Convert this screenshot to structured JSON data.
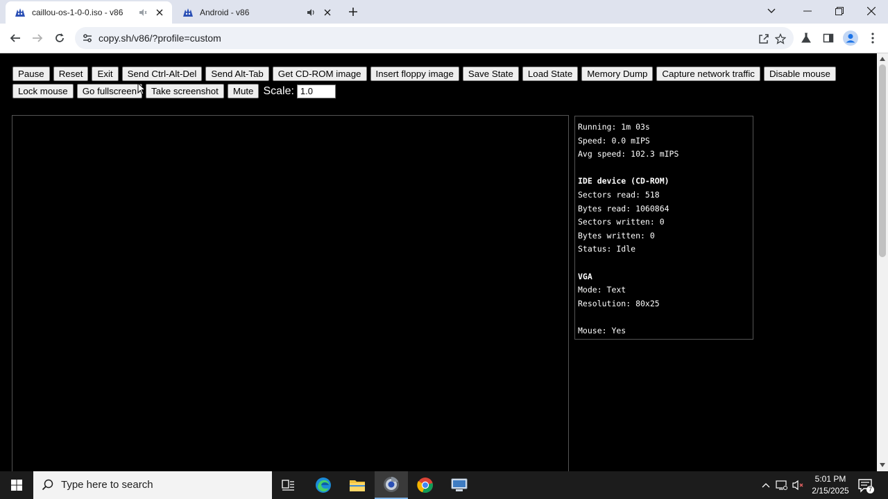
{
  "browser": {
    "tabs": [
      {
        "title": "caillou-os-1-0-0.iso - v86",
        "active": true
      },
      {
        "title": "Android - v86",
        "active": false
      }
    ],
    "url": "copy.sh/v86/?profile=custom"
  },
  "controls": {
    "row1": [
      "Pause",
      "Reset",
      "Exit",
      "Send Ctrl-Alt-Del",
      "Send Alt-Tab",
      "Get CD-ROM image",
      "Insert floppy image",
      "Save State",
      "Load State",
      "Memory Dump",
      "Capture network traffic",
      "Disable mouse"
    ],
    "row2": [
      "Lock mouse",
      "Go fullscreen",
      "Take screenshot",
      "Mute"
    ],
    "scale_label": "Scale:",
    "scale_value": "1.0"
  },
  "stats": {
    "running": "Running: 1m 03s",
    "speed": "Speed: 0.0 mIPS",
    "avg_speed": "Avg speed: 102.3 mIPS",
    "ide_heading": "IDE device (CD-ROM)",
    "sectors_read": "Sectors read: 518",
    "bytes_read": "Bytes read: 1060864",
    "sectors_written": "Sectors written: 0",
    "bytes_written": "Bytes written: 0",
    "status": "Status: Idle",
    "vga_heading": "VGA",
    "mode": "Mode: Text",
    "resolution": "Resolution: 80x25",
    "mouse": "Mouse: Yes"
  },
  "taskbar": {
    "search_placeholder": "Type here to search",
    "time": "5:01 PM",
    "date": "2/15/2025",
    "notification_count": "7"
  },
  "icons": {
    "tab_favicon": "v86-icon",
    "accent": "#1a73e8"
  }
}
